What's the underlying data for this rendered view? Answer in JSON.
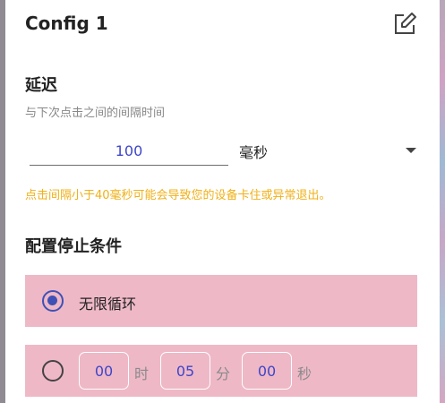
{
  "dialog": {
    "title": "Config 1"
  },
  "delay": {
    "heading": "延迟",
    "subtitle": "与下次点击之间的间隔时间",
    "value": "100",
    "unit": "毫秒",
    "warning": "点击间隔小于40毫秒可能会导致您的设备卡住或异常退出。"
  },
  "stop_condition": {
    "heading": "配置停止条件",
    "infinite_label": "无限循环",
    "timer": {
      "hours": "00",
      "hours_unit": "时",
      "minutes": "05",
      "minutes_unit": "分",
      "seconds": "00",
      "seconds_unit": "秒"
    }
  },
  "colors": {
    "accent": "#3f51b5",
    "warning": "#f0b018",
    "option_bg": "#eeb8c7"
  }
}
